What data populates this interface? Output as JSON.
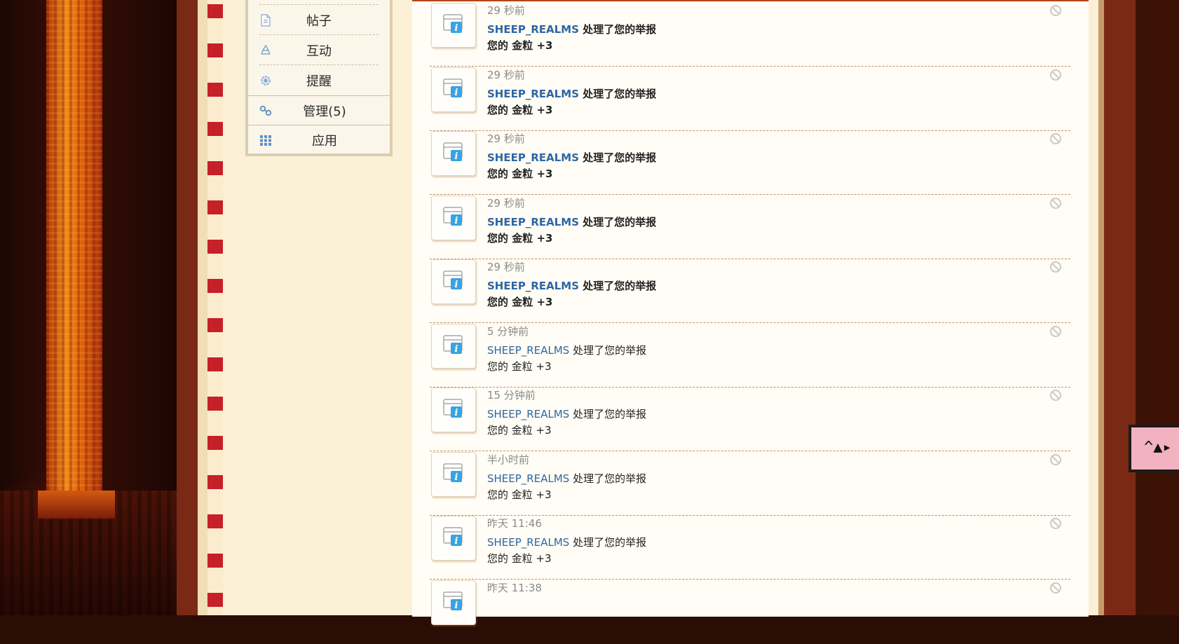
{
  "sidebar": {
    "items": [
      {
        "label": "帖子",
        "icon": "document-icon"
      },
      {
        "label": "互动",
        "icon": "recycle-icon"
      },
      {
        "label": "提醒",
        "icon": "gear-icon"
      },
      {
        "label": "管理(5)",
        "icon": "link-icon"
      },
      {
        "label": "应用",
        "icon": "grid-icon"
      }
    ]
  },
  "notifications": [
    {
      "time": "29 秒前",
      "user": "SHEEP_REALMS",
      "action": "处理了您的举报",
      "detail": "您的 金粒 +3",
      "unread": true
    },
    {
      "time": "29 秒前",
      "user": "SHEEP_REALMS",
      "action": "处理了您的举报",
      "detail": "您的 金粒 +3",
      "unread": true
    },
    {
      "time": "29 秒前",
      "user": "SHEEP_REALMS",
      "action": "处理了您的举报",
      "detail": "您的 金粒 +3",
      "unread": true
    },
    {
      "time": "29 秒前",
      "user": "SHEEP_REALMS",
      "action": "处理了您的举报",
      "detail": "您的 金粒 +3",
      "unread": true
    },
    {
      "time": "29 秒前",
      "user": "SHEEP_REALMS",
      "action": "处理了您的举报",
      "detail": "您的 金粒 +3",
      "unread": true
    },
    {
      "time": "5 分钟前",
      "user": "SHEEP_REALMS",
      "action": "处理了您的举报",
      "detail": "您的 金粒 +3",
      "unread": false
    },
    {
      "time": "15 分钟前",
      "user": "SHEEP_REALMS",
      "action": "处理了您的举报",
      "detail": "您的 金粒 +3",
      "unread": false
    },
    {
      "time": "半小时前",
      "user": "SHEEP_REALMS",
      "action": "处理了您的举报",
      "detail": "您的 金粒 +3",
      "unread": false
    },
    {
      "time": "昨天 11:46",
      "user": "SHEEP_REALMS",
      "action": "处理了您的举报",
      "detail": "您的 金粒 +3",
      "unread": false
    },
    {
      "time": "昨天 11:38",
      "user": "",
      "action": "",
      "detail": "",
      "unread": false
    }
  ],
  "colors": {
    "link": "#2f66a2",
    "time": "#8a8a8a",
    "separator": "#c58c66",
    "panel": "#fffdf5",
    "sidebar": "#fbf1d7"
  }
}
